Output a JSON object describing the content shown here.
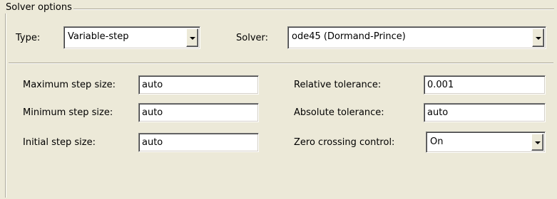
{
  "solver_options": {
    "legend": "Solver options",
    "type_label": "Type:",
    "type_value": "Variable-step",
    "solver_label": "Solver:",
    "solver_value": "ode45 (Dormand-Prince)"
  },
  "step_options": {
    "max_step_label": "Maximum step size:",
    "max_step_value": "auto",
    "min_step_label": "Minimum step size:",
    "min_step_value": "auto",
    "initial_step_label": "Initial step size:",
    "initial_step_value": "auto"
  },
  "tolerance_options": {
    "relative_label": "Relative tolerance:",
    "relative_value": "0.001",
    "absolute_label": "Absolute tolerance:",
    "absolute_value": "auto",
    "zero_crossing_label": "Zero crossing control:",
    "zero_crossing_value": "On"
  },
  "icons": {
    "dropdown": "chevron-down-icon"
  }
}
